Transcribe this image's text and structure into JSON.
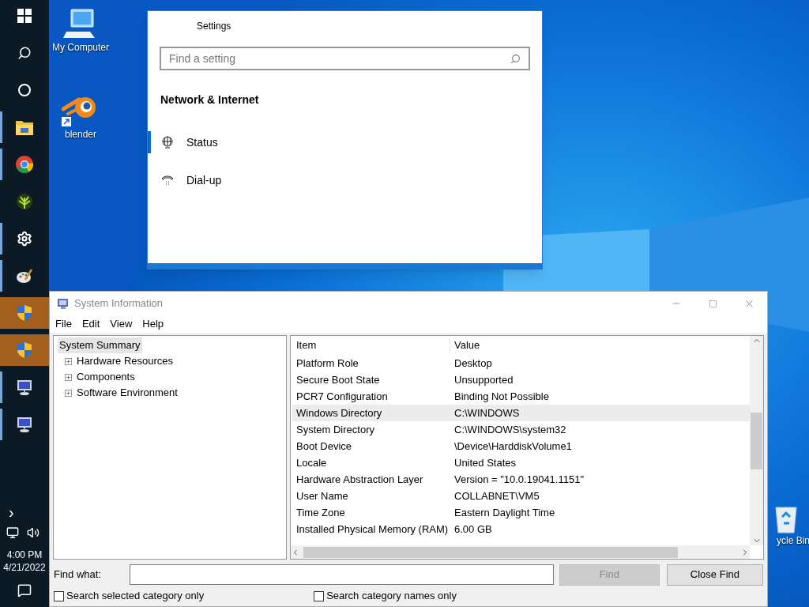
{
  "taskbar": {
    "apps": [
      {
        "kind": "windows-logo",
        "active": false,
        "running": false
      },
      {
        "kind": "search",
        "active": false,
        "running": false
      },
      {
        "kind": "circle",
        "active": false,
        "running": false
      },
      {
        "kind": "folder",
        "active": false,
        "running": true
      },
      {
        "kind": "chrome",
        "active": false,
        "running": true
      },
      {
        "kind": "plant",
        "active": false,
        "running": false
      },
      {
        "kind": "gear",
        "active": false,
        "running": true
      },
      {
        "kind": "palette",
        "active": false,
        "running": true
      },
      {
        "kind": "shield",
        "active": true,
        "running": false
      },
      {
        "kind": "shield",
        "active": true,
        "running": false
      },
      {
        "kind": "monitor",
        "active": false,
        "running": true
      },
      {
        "kind": "monitor",
        "active": false,
        "running": true
      }
    ],
    "tray": {
      "chevron": "›",
      "time": "4:00 PM",
      "date": "4/21/2022"
    }
  },
  "desktop_icons": [
    {
      "kind": "computer",
      "label": "My Computer"
    },
    {
      "kind": "blender",
      "label": "blender"
    },
    {
      "kind": "recycle-bin",
      "label": "ycle Bin"
    }
  ],
  "settings_window": {
    "title": "Settings",
    "search": {
      "placeholder": "Find a setting"
    },
    "heading": "Network & Internet",
    "items": [
      {
        "kind": "globe",
        "label": "Status",
        "selected": true
      },
      {
        "kind": "phone",
        "label": "Dial-up",
        "selected": false
      }
    ]
  },
  "system_information": {
    "title": "System Information",
    "menu": [
      "File",
      "Edit",
      "View",
      "Help"
    ],
    "tree": [
      {
        "label": "System Summary",
        "selected": true,
        "children": [
          {
            "label": "Hardware Resources",
            "expanded": false
          },
          {
            "label": "Components",
            "expanded": false
          },
          {
            "label": "Software Environment",
            "expanded": false
          }
        ]
      }
    ],
    "table": {
      "columns": [
        "Item",
        "Value"
      ],
      "rows": [
        {
          "item": "Platform Role",
          "value": "Desktop",
          "selected": false
        },
        {
          "item": "Secure Boot State",
          "value": "Unsupported",
          "selected": false
        },
        {
          "item": "PCR7 Configuration",
          "value": "Binding Not Possible",
          "selected": false
        },
        {
          "item": "Windows Directory",
          "value": "C:\\WINDOWS",
          "selected": true
        },
        {
          "item": "System Directory",
          "value": "C:\\WINDOWS\\system32",
          "selected": false
        },
        {
          "item": "Boot Device",
          "value": "\\Device\\HarddiskVolume1",
          "selected": false
        },
        {
          "item": "Locale",
          "value": "United States",
          "selected": false
        },
        {
          "item": "Hardware Abstraction Layer",
          "value": "Version = \"10.0.19041.1151\"",
          "selected": false
        },
        {
          "item": "User Name",
          "value": "COLLABNET\\VM5",
          "selected": false
        },
        {
          "item": "Time Zone",
          "value": "Eastern Daylight Time",
          "selected": false
        },
        {
          "item": "Installed Physical Memory (RAM)",
          "value": "6.00 GB",
          "selected": false
        }
      ]
    },
    "find": {
      "label": "Find what:",
      "find_button": {
        "label": "Find",
        "disabled": true
      },
      "close_button": "Close Find",
      "options": [
        {
          "label": "Search selected category only",
          "checked": false
        },
        {
          "label": "Search category names only",
          "checked": false
        }
      ]
    }
  }
}
